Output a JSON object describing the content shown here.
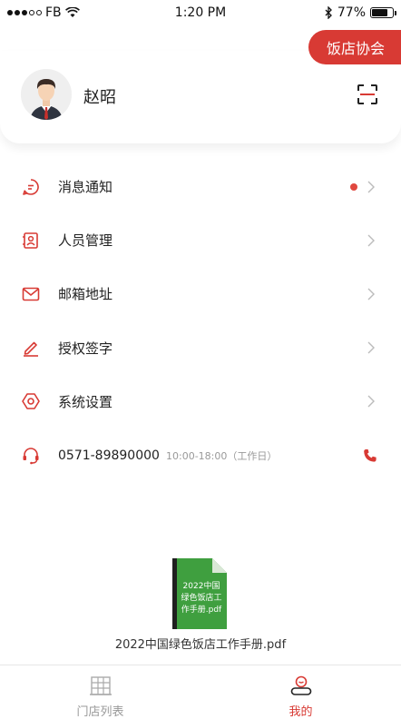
{
  "status_bar": {
    "carrier": "FB",
    "time": "1:20 PM",
    "battery": "77%",
    "battery_level": 0.77
  },
  "header": {
    "association_label": "饭店协会"
  },
  "profile": {
    "name": "赵昭"
  },
  "menu": {
    "items": [
      {
        "label": "消息通知",
        "icon": "message-icon",
        "has_dot": true
      },
      {
        "label": "人员管理",
        "icon": "contact-card-icon"
      },
      {
        "label": "邮箱地址",
        "icon": "mail-icon"
      },
      {
        "label": "授权签字",
        "icon": "pen-icon"
      },
      {
        "label": "系统设置",
        "icon": "settings-icon"
      }
    ],
    "contact": {
      "phone": "0571-89890000",
      "hours": "10:00-18:00（工作日）",
      "icon": "headset-icon"
    }
  },
  "document": {
    "thumb_text": "2022中国绿色饭店工作手册.pdf",
    "filename": "2022中国绿色饭店工作手册.pdf"
  },
  "tab_bar": {
    "tabs": [
      {
        "label": "门店列表",
        "icon": "building-icon",
        "active": false
      },
      {
        "label": "我的",
        "icon": "profile-icon",
        "active": true
      }
    ]
  },
  "colors": {
    "accent": "#d83a34",
    "dot": "#e0483f",
    "pdf_green": "#3f9f3f"
  }
}
